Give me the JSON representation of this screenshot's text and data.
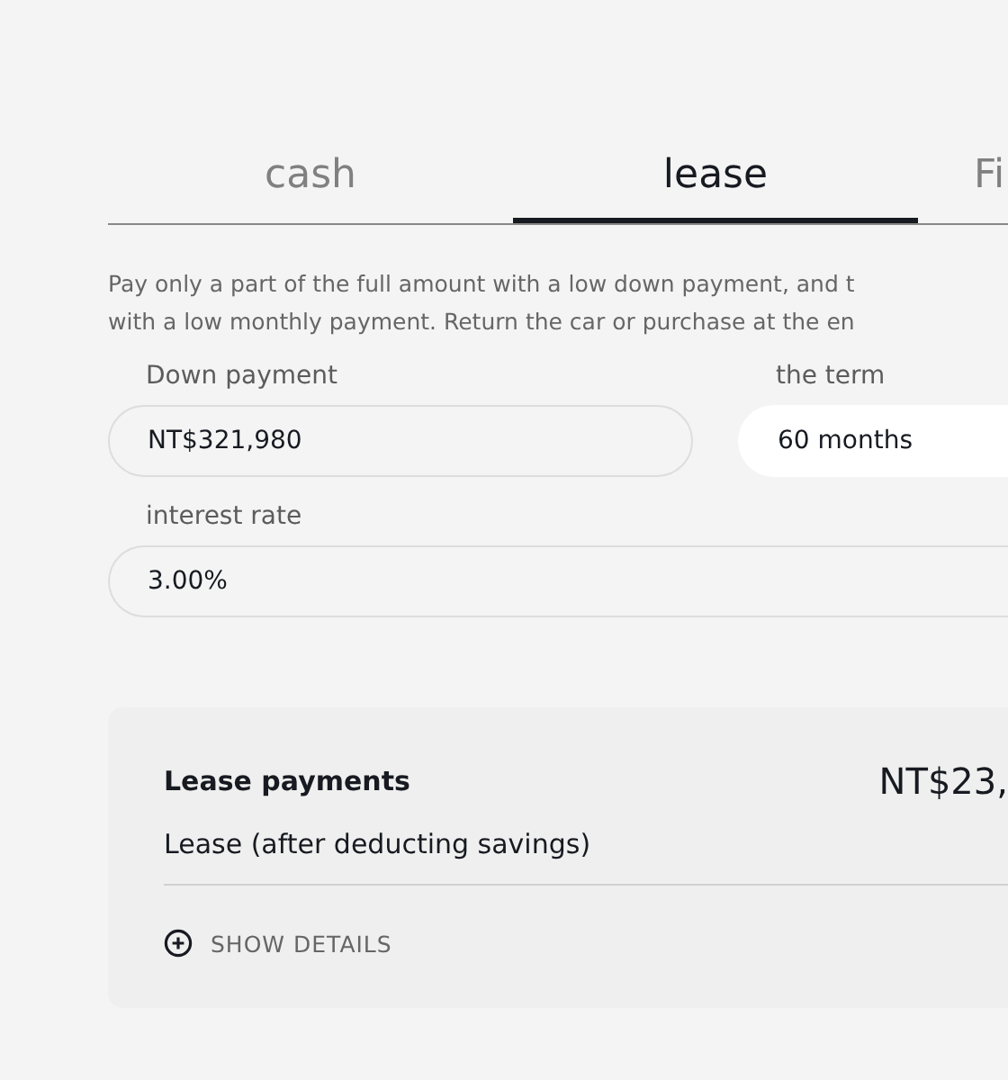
{
  "tabs": [
    {
      "label": "cash",
      "selected": false
    },
    {
      "label": "lease",
      "selected": true
    },
    {
      "label": "Fi",
      "selected": false
    }
  ],
  "description": [
    "Pay only a part of the full amount with a low down payment, and t",
    "with a low monthly payment. Return the car or purchase at the en"
  ],
  "fields": [
    {
      "label": "Down payment",
      "value": "NT$321,980",
      "kind": "input"
    },
    {
      "label": "the term",
      "value": "60 months",
      "kind": "select"
    },
    {
      "label": "interest rate",
      "value": "3.00%",
      "kind": "input"
    }
  ],
  "summary": {
    "rows": [
      {
        "label": "Lease payments",
        "value": "NT$23,",
        "kind": "primary"
      },
      {
        "label": "Lease (after deducting savings)",
        "kind": "secondary"
      }
    ],
    "details_link": "SHOW DETAILS"
  }
}
